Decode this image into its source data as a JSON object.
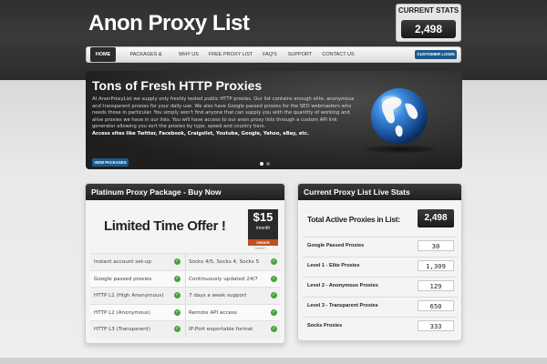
{
  "header": {
    "logo": "Anon Proxy List",
    "stats_title": "CURRENT STATS",
    "stats_value": "2,498"
  },
  "nav": {
    "items": [
      {
        "label": "HOME",
        "active": true
      },
      {
        "label": "PACKAGES & PRICING"
      },
      {
        "label": "WHY US"
      },
      {
        "label": "FREE PROXY LIST"
      },
      {
        "label": "FAQ'S"
      },
      {
        "label": "SUPPORT"
      },
      {
        "label": "CONTACT US"
      }
    ],
    "login_label": "CUSTOMER LOGIN"
  },
  "hero": {
    "title": "Tons of Fresh HTTP Proxies",
    "body": "At AnonProxyList we supply only freshly tested public HTTP proxies. Our list contains enough elite, anonymous and transparent proxies for your daily use. We also have Google passed proxies for the SEO webmasters who needs those in particular. You simply won't find anyone that can supply you with the quantity of working and alive proxies we have in our lists. You will have access to our anon proxy lists through a custom API link generator allowing you sort the proxies by type, speed and country tiers.",
    "sites": "Access sites like Twitter, Facebook, Craigslist, Youtube, Google, Yahoo, eBay, etc.",
    "button": "VIEW PACKAGES"
  },
  "package": {
    "title": "Platinum Proxy Package - Buy Now",
    "offer": "Limited Time Offer !",
    "price": "$15",
    "period": "/month",
    "order": "ORDER",
    "order_sub": "NOW!!",
    "features": [
      [
        "Instant account set-up",
        "Socks 4/5, Socks 4, Socks 5"
      ],
      [
        "Google passed proxies",
        "Continuously updated 24/7"
      ],
      [
        "HTTP L1 (High Anonymous)",
        "7 days a week support"
      ],
      [
        "HTTP L2 (Anonymous)",
        "Remote API access"
      ],
      [
        "HTTP L3 (Transparent)",
        "IP:Port exportable format"
      ]
    ]
  },
  "live_stats": {
    "title": "Current Proxy List Live Stats",
    "total_label": "Total Active Proxies in List:",
    "total_value": "2,498",
    "rows": [
      {
        "label": "Google Passed Proxies",
        "value": "30"
      },
      {
        "label": "Level 1 - Elite Proxies",
        "value": "1,309"
      },
      {
        "label": "Level 2 - Anonymous Proxies",
        "value": "129"
      },
      {
        "label": "Level 3 - Transparent Proxies",
        "value": "650"
      },
      {
        "label": "Socks Proxies",
        "value": "333"
      }
    ]
  },
  "colors": {
    "accent_blue": "#1c5a8c",
    "check_green": "#45a33a",
    "order_orange": "#c0501c"
  }
}
